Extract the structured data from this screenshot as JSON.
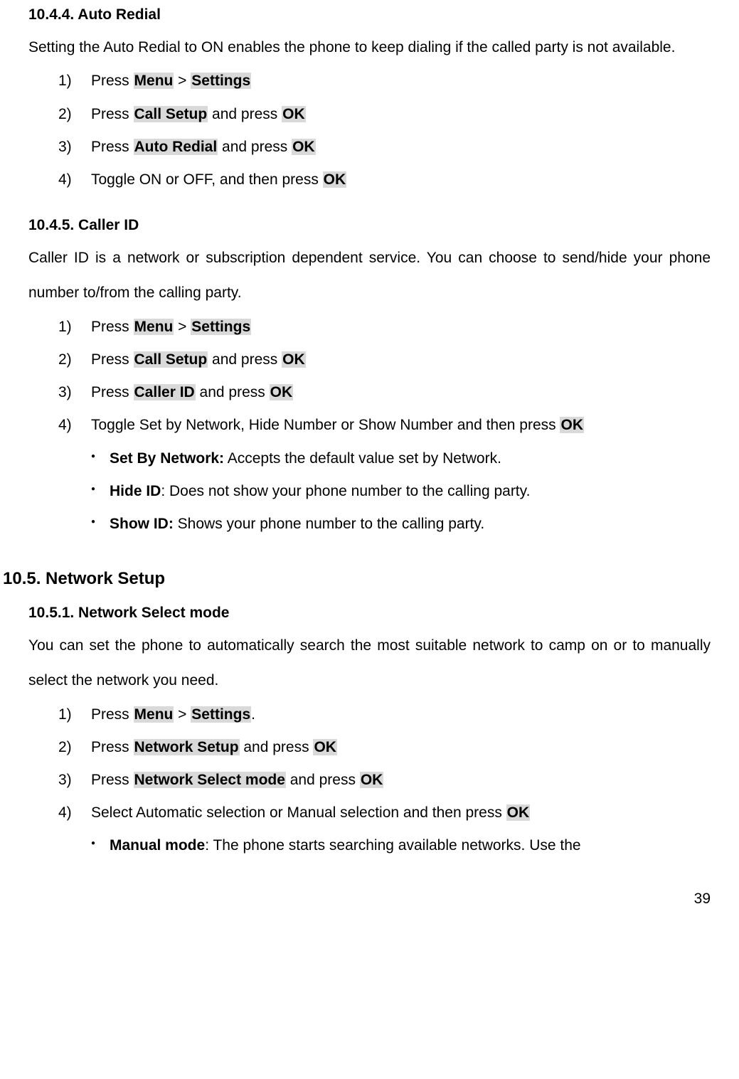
{
  "s1": {
    "title": "10.4.4. Auto Redial",
    "para": "Setting the Auto Redial to ON enables the phone to keep dialing if the called party is not available.",
    "items": [
      {
        "n": "1)",
        "pre": "Press ",
        "hl1": "Menu",
        "mid": " > ",
        "hl2": "Settings"
      },
      {
        "n": "2)",
        "pre": "Press ",
        "hl1": "Call Setup",
        "mid": " and press ",
        "hl2": "OK"
      },
      {
        "n": "3)",
        "pre": "Press ",
        "hl1": "Auto Redial",
        "mid": " and press ",
        "hl2": "OK"
      },
      {
        "n": "4)",
        "pre": "Toggle ON or OFF, and then press ",
        "hl1": "OK"
      }
    ]
  },
  "s2": {
    "title": "10.4.5. Caller ID",
    "para": "Caller ID is a network or subscription dependent service. You can choose to send/hide your phone number to/from the calling party.",
    "items": [
      {
        "n": "1)",
        "pre": "Press ",
        "hl1": "Menu",
        "mid": " > ",
        "hl2": "Settings"
      },
      {
        "n": "2)",
        "pre": "Press ",
        "hl1": "Call Setup",
        "mid": " and press ",
        "hl2": "OK"
      },
      {
        "n": "3)",
        "pre": "Press ",
        "hl1": "Caller ID",
        "mid": " and press ",
        "hl2": "OK"
      },
      {
        "n": "4)",
        "pre": "Toggle Set by Network, Hide Number or Show Number and then press ",
        "hl1": "OK"
      }
    ],
    "sub": [
      {
        "b": "Set By Network:",
        "t": " Accepts the default value set by Network."
      },
      {
        "b": "Hide ID",
        "t": ": Does not show your phone number to the calling party."
      },
      {
        "b": "Show ID:",
        "t": " Shows your phone number to the calling party."
      }
    ]
  },
  "s3": {
    "heading": "10.5. Network Setup",
    "title": "10.5.1. Network Select mode",
    "para": "You can set the phone to automatically search the most suitable network to camp on or to manually select the network you need.",
    "items": [
      {
        "n": "1)",
        "pre": "Press ",
        "hl1": "Menu",
        "mid": " > ",
        "hl2": "Settings",
        "post": "."
      },
      {
        "n": "2)",
        "pre": "Press ",
        "hl1": "Network Setup",
        "mid": " and press ",
        "hl2": "OK"
      },
      {
        "n": "3)",
        "pre": "Press ",
        "hl1": "Network Select mode",
        "mid": " and press ",
        "hl2": "OK"
      },
      {
        "n": "4)",
        "pre": "Select Automatic selection or Manual selection and then press ",
        "hl1": "OK"
      }
    ],
    "sub": [
      {
        "b": "Manual mode",
        "t": ": The phone starts searching available networks. Use the"
      }
    ]
  },
  "pageNum": "39"
}
